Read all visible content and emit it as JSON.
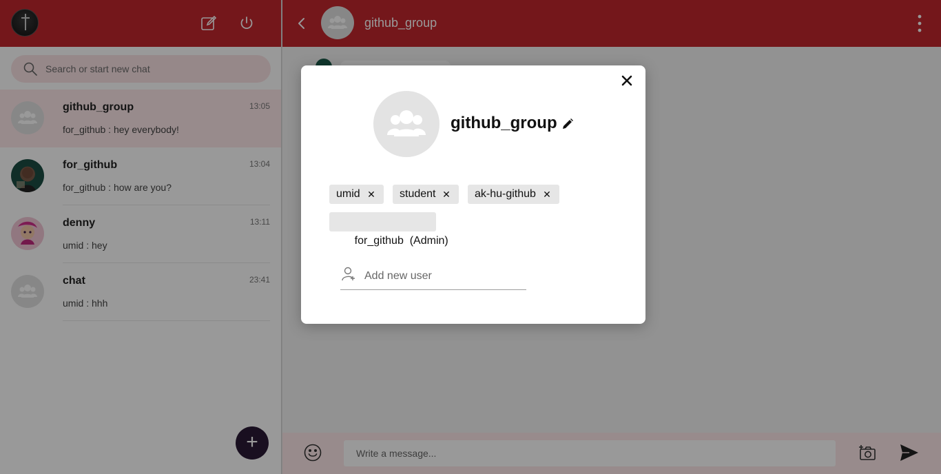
{
  "sidebar": {
    "search_placeholder": "Search or start new chat",
    "chats": [
      {
        "name": "github_group",
        "time": "13:05",
        "last_message": "for_github : hey everybody!",
        "avatar": "group-avatar-icon",
        "active": true
      },
      {
        "name": "for_github",
        "time": "13:04",
        "last_message": "for_github : how are you?",
        "avatar": "photo",
        "active": false
      },
      {
        "name": "denny",
        "time": "13:11",
        "last_message": "umid : hey",
        "avatar": "anime-photo",
        "active": false
      },
      {
        "name": "chat",
        "time": "23:41",
        "last_message": "umid : hhh",
        "avatar": "group-avatar-icon",
        "active": false
      }
    ],
    "fab_label": "+"
  },
  "conversation": {
    "title": "github_group",
    "message_placeholder": "Write a message..."
  },
  "modal": {
    "group_name": "github_group",
    "members": [
      {
        "name": "umid",
        "removable": true
      },
      {
        "name": "student",
        "removable": true
      },
      {
        "name": "ak-hu-github",
        "removable": true
      },
      {
        "name": "for_github  (Admin)",
        "removable": false
      }
    ],
    "remove_symbol": "✕",
    "add_user_placeholder": "Add new user"
  },
  "colors": {
    "header": "#c1272d",
    "active_chat": "#fde8ea",
    "search_bg": "#fbe3e5",
    "fab": "#2a1a36"
  }
}
